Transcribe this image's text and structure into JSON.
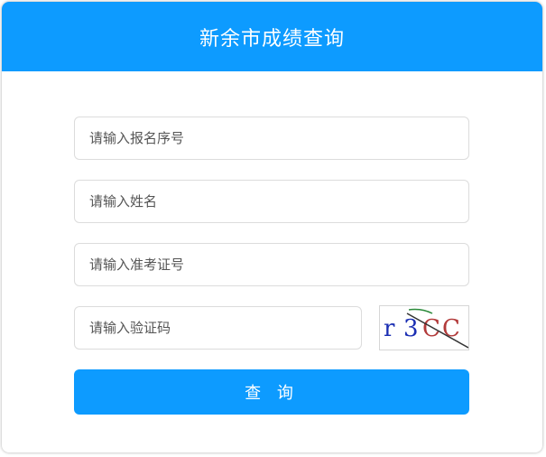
{
  "header": {
    "title": "新余市成绩查询"
  },
  "form": {
    "registration_no_placeholder": "请输入报名序号",
    "name_placeholder": "请输入姓名",
    "admission_no_placeholder": "请输入准考证号",
    "captcha_placeholder": "请输入验证码",
    "submit_label": "查 询"
  },
  "captcha": {
    "char_1": "r",
    "char_2": "3",
    "char_3": "C",
    "char_4": "C"
  },
  "colors": {
    "primary": "#0d9bff",
    "captcha_blue": "#1b2fb3",
    "captcha_red": "#b23a3a",
    "captcha_line": "#2a8a3a"
  }
}
